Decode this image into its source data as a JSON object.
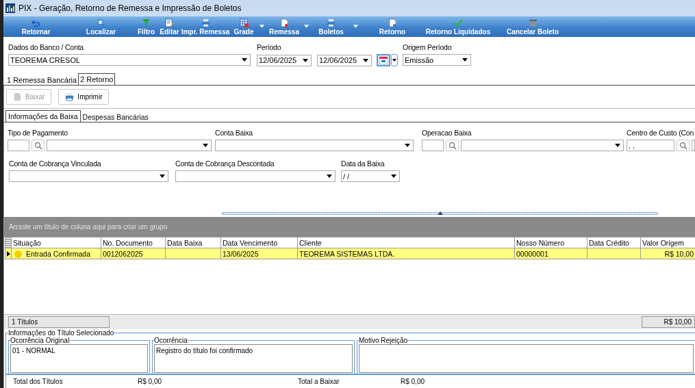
{
  "window": {
    "title": "PIX - Geração, Retorno de Remessa e Impressão de Boletos"
  },
  "toolbar": [
    {
      "label": "Retornar",
      "has_menu": false
    },
    {
      "label": "Localizar",
      "has_menu": false
    },
    {
      "label": "Filtro",
      "has_menu": false
    },
    {
      "label": "Editar",
      "has_menu": false
    },
    {
      "label": "Impr. Remessa",
      "has_menu": false
    },
    {
      "label": "Grade",
      "has_menu": true
    },
    {
      "label": "Remessa",
      "has_menu": true
    },
    {
      "label": "Boletos",
      "has_menu": true
    },
    {
      "label": "Retorno",
      "has_menu": false
    },
    {
      "label": "Retorno Liquidados",
      "has_menu": false
    },
    {
      "label": "Cancelar Boleto",
      "has_menu": false
    }
  ],
  "filters": {
    "bank": {
      "label": "Dados do Banco / Conta",
      "value": "TEOREMA CRESOL"
    },
    "period": {
      "label": "Período",
      "from": "12/06/2025",
      "to": "12/06/2025"
    },
    "origin": {
      "label": "Origem Período",
      "value": "Emissão"
    }
  },
  "tabs": [
    {
      "label": "1 Remessa Bancária",
      "selected": false
    },
    {
      "label": "2 Retorno",
      "selected": true
    }
  ],
  "actions": [
    {
      "label": "Baixar",
      "disabled": true
    },
    {
      "label": "Imprimir",
      "disabled": false
    }
  ],
  "subtabs": [
    {
      "label": "Informações da Baixa",
      "selected": true
    },
    {
      "label": "Despesas Bancárias",
      "selected": false
    }
  ],
  "form_rows": [
    [
      {
        "kind": "lookup",
        "label": "Tipo de Pagamento"
      },
      {
        "kind": "combo",
        "label": "Conta Baixa"
      },
      {
        "kind": "lookup",
        "label": "Operacao Baixa"
      },
      {
        "kind": "masked",
        "label": "Centro de Custo (Con",
        "value": ". ."
      }
    ],
    [
      {
        "kind": "combo",
        "label": "Conta de Cobrança Vinculada"
      },
      {
        "kind": "combo",
        "label": "Conta de Cobrança Descontada"
      },
      {
        "kind": "combo",
        "label": "Data da Baixa",
        "value": "/ /"
      }
    ]
  ],
  "grid": {
    "group_hint": "Arraste um título de coluna aqui para criar um grupo",
    "columns": [
      "Situação",
      "No. Documento",
      "Data Baixa",
      "Data Vencimento",
      "Cliente",
      "Nosso Número",
      "Data Crédito",
      "Valor Origem"
    ],
    "rows": [
      {
        "selected": true,
        "color": "#f5d000",
        "cells": [
          "Entrada Confirmada",
          "0012062025",
          "",
          "13/06/2025",
          "TEOREMA SISTEMAS LTDA.",
          "00000001",
          "",
          "R$ 10,00"
        ]
      }
    ],
    "count": "1 Títulos",
    "total": "R$ 10,00"
  },
  "details": {
    "title": "Informações do Título Selecionado",
    "boxes": [
      {
        "label": "Ocorrência Original",
        "value": "01 - NORMAL"
      },
      {
        "label": "Ocorrência",
        "value": "Registro do título foi confirmado"
      },
      {
        "label": "Motivo Rejeição"
      }
    ]
  },
  "totals": [
    {
      "label": "Total dos Títulos",
      "value": "R$ 0,00"
    },
    {
      "label": "Total a Baixar",
      "value": "R$ 0,00"
    }
  ]
}
